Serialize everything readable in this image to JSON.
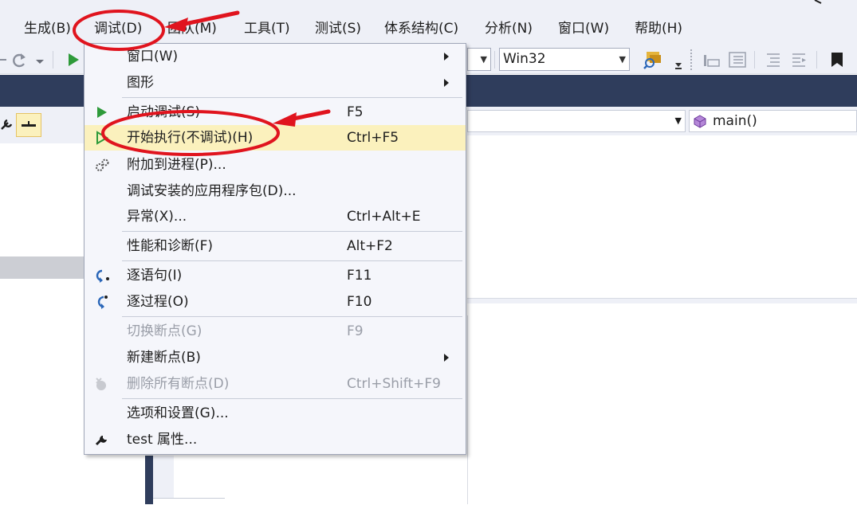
{
  "menubar": {
    "items": [
      "生成(B)",
      "调试(D)",
      "团队(M)",
      "工具(T)",
      "测试(S)",
      "体系结构(C)",
      "分析(N)",
      "窗口(W)",
      "帮助(H)"
    ]
  },
  "toolbar": {
    "platform_combo": "Win32"
  },
  "editor": {
    "function_combo": "main()"
  },
  "debug_menu": {
    "items": [
      {
        "label": "窗口(W)",
        "shortcut": "",
        "submenu": true
      },
      {
        "label": "图形",
        "shortcut": "",
        "submenu": true
      },
      {
        "label": "启动调试(S)",
        "shortcut": "F5"
      },
      {
        "label": "开始执行(不调试)(H)",
        "shortcut": "Ctrl+F5"
      },
      {
        "label": "附加到进程(P)...",
        "shortcut": ""
      },
      {
        "label": "调试安装的应用程序包(D)...",
        "shortcut": ""
      },
      {
        "label": "异常(X)...",
        "shortcut": "Ctrl+Alt+E"
      },
      {
        "label": "性能和诊断(F)",
        "shortcut": "Alt+F2"
      },
      {
        "label": "逐语句(I)",
        "shortcut": "F11"
      },
      {
        "label": "逐过程(O)",
        "shortcut": "F10"
      },
      {
        "label": "切换断点(G)",
        "shortcut": "F9",
        "disabled": true
      },
      {
        "label": "新建断点(B)",
        "shortcut": "",
        "submenu": true
      },
      {
        "label": "删除所有断点(D)",
        "shortcut": "Ctrl+Shift+F9",
        "disabled": true
      },
      {
        "label": "选项和设置(G)...",
        "shortcut": ""
      },
      {
        "label": "test 属性...",
        "shortcut": ""
      }
    ]
  },
  "colors": {
    "annotation": "#e0141e",
    "highlight": "#fbf1bd",
    "dark_bar": "#2f3d5c"
  }
}
